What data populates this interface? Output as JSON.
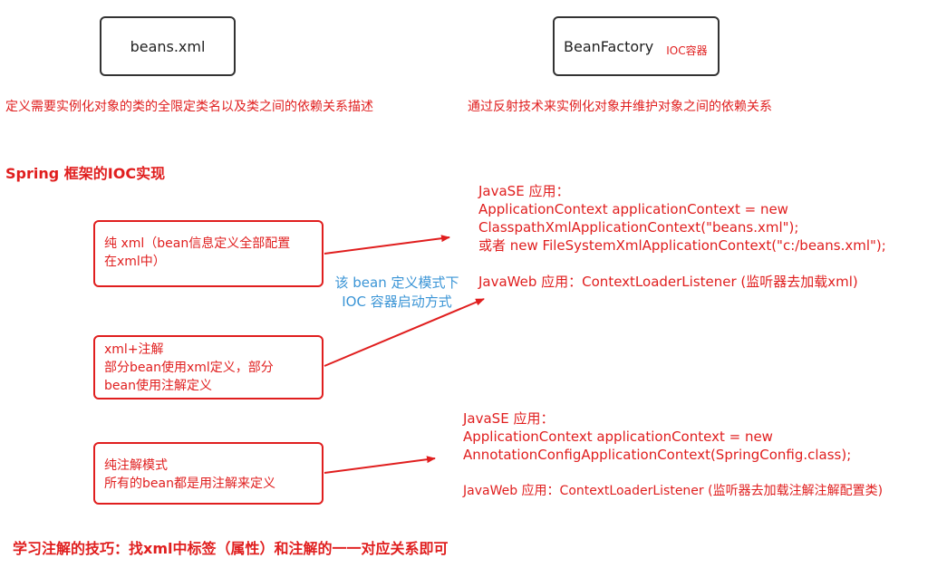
{
  "top": {
    "beans_box": "beans.xml",
    "factory_box": "BeanFactory",
    "ioc_tag": "IOC容器",
    "beans_desc": "定义需要实例化对象的类的全限定类名以及类之间的依赖关系描述",
    "factory_desc": "通过反射技术来实例化对象并维护对象之间的依赖关系"
  },
  "section_title": "Spring 框架的IOC实现",
  "modes": {
    "pure_xml": [
      "纯 xml（bean信息定义全部配置",
      "在xml中）"
    ],
    "xml_annotation": [
      "xml+注解",
      "部分bean使用xml定义，部分",
      "bean使用注解定义"
    ],
    "pure_annotation": [
      "纯注解模式",
      "所有的bean都是用注解来定义"
    ]
  },
  "middle_note": [
    "该 bean 定义模式下",
    "IOC 容器启动方式"
  ],
  "xml_startup": {
    "lines": [
      "JavaSE 应用：",
      "ApplicationContext applicationContext = new",
      "ClasspathXmlApplicationContext(\"beans.xml\");",
      "或者 new FileSystemXmlApplicationContext(\"c:/beans.xml\");"
    ],
    "web": "JavaWeb 应用：ContextLoaderListener (监听器去加载xml)"
  },
  "annotation_startup": {
    "lines": [
      "JavaSE 应用：",
      "ApplicationContext applicationContext = new",
      "AnnotationConfigApplicationContext(SpringConfig.class);"
    ],
    "web": "JavaWeb 应用：ContextLoaderListener (监听器去加载注解注解配置类)"
  },
  "footer_tip": "学习注解的技巧：找xml中标签（属性）和注解的一一对应关系即可",
  "colors": {
    "red": "#e01e1e",
    "blue": "#3b95d6",
    "box_border": "#333333"
  }
}
